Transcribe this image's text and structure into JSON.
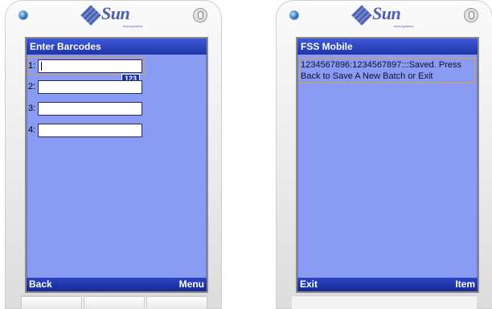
{
  "left_phone": {
    "brand": "Sun",
    "brand_sub": "microsystems",
    "screen_title": "Enter Barcodes",
    "rows": [
      {
        "label": "1:",
        "value": ""
      },
      {
        "label": "2:",
        "value": ""
      },
      {
        "label": "3:",
        "value": ""
      },
      {
        "label": "4:",
        "value": ""
      }
    ],
    "input_mode": "123",
    "softkey_left": "Back",
    "softkey_right": "Menu"
  },
  "right_phone": {
    "brand": "Sun",
    "brand_sub": "microsystems",
    "screen_title": "FSS Mobile",
    "message": "1234567896:1234567897:::Saved. Press Back to Save A New Batch or Exit",
    "softkey_left": "Exit",
    "softkey_right": "Item"
  },
  "colors": {
    "screen_bg": "#8a9bf3",
    "titlebar": "#2a44c4",
    "focus_outline": "#d6a34b"
  }
}
